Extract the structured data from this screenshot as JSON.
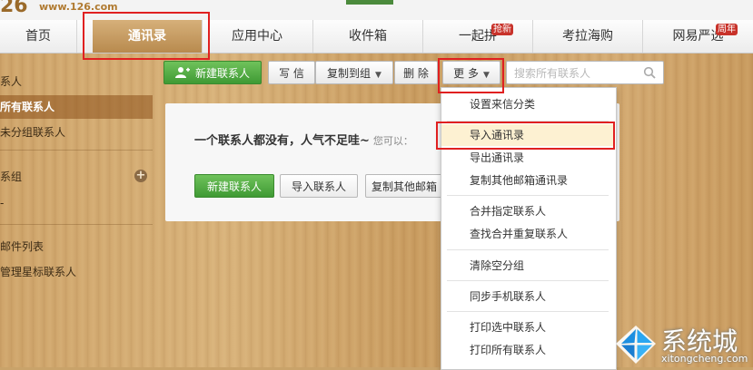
{
  "header": {
    "logo_fragment": "26",
    "url": "www.126.com"
  },
  "tabs": [
    {
      "label": "首页"
    },
    {
      "label": "通讯录",
      "active": true
    },
    {
      "label": "应用中心"
    },
    {
      "label": "收件箱"
    },
    {
      "label": "一起拼",
      "badge": "抢新"
    },
    {
      "label": "考拉海购"
    },
    {
      "label": "网易严选",
      "badge": "周年"
    }
  ],
  "sidebar": {
    "items": [
      {
        "label": "系人"
      },
      {
        "label": "所有联系人",
        "active": true
      },
      {
        "label": "未分组联系人"
      },
      {
        "label": "系组",
        "icon": "plus-icon"
      },
      {
        "label": "-"
      },
      {
        "label": "邮件列表"
      },
      {
        "label": "管理星标联系人"
      }
    ]
  },
  "toolbar": {
    "new_contact": "新建联系人",
    "write": "写 信",
    "copy_to_group": "复制到组",
    "delete": "删 除",
    "more": "更 多",
    "search_placeholder": "搜索所有联系人"
  },
  "content": {
    "message": "一个联系人都没有，人气不足哇~",
    "sub": "您可以：",
    "buttons": [
      "新建联系人",
      "导入联系人",
      "复制其他邮箱"
    ]
  },
  "dropdown": {
    "items": [
      "设置来信分类",
      "导入通讯录",
      "导出通讯录",
      "复制其他邮箱通讯录",
      "合并指定联系人",
      "查找合并重复联系人",
      "清除空分组",
      "同步手机联系人",
      "打印选中联系人",
      "打印所有联系人"
    ]
  },
  "watermark": {
    "cn": "系统城",
    "en": "xitongcheng.com"
  },
  "colors": {
    "accent_green": "#3f9a34",
    "highlight_red": "#e02020",
    "badge_red": "#c8322a",
    "active_tab": "#b88a4e"
  }
}
